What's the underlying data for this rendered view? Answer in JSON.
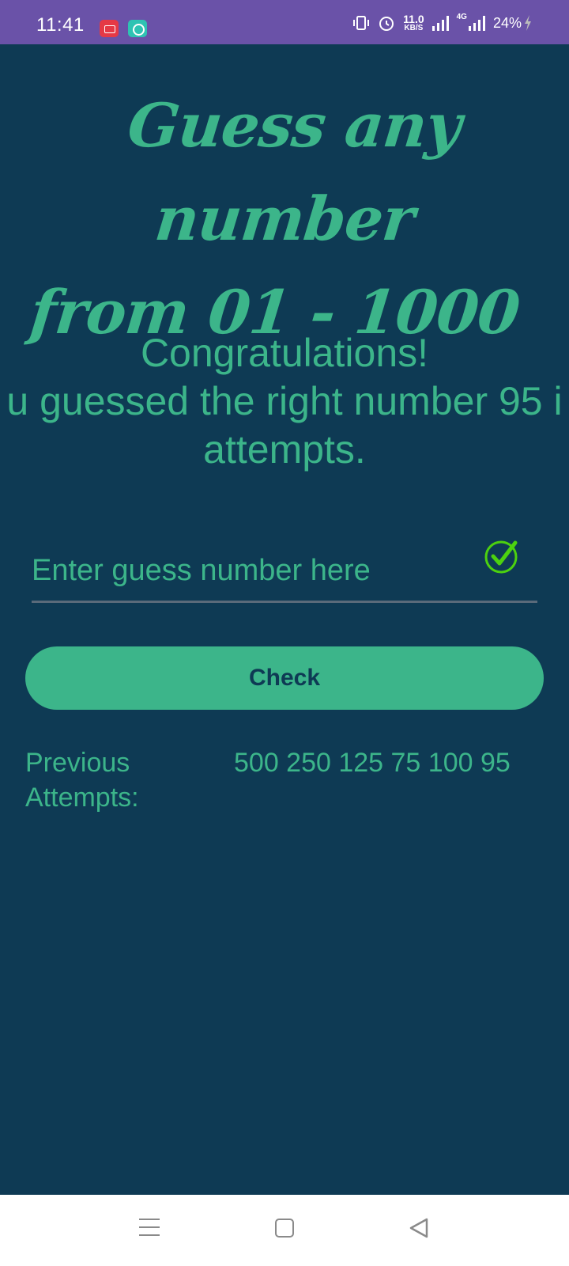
{
  "status_bar": {
    "time": "11:41",
    "speed_value": "11.0",
    "speed_unit": "KB/S",
    "network": "4G",
    "battery": "24%"
  },
  "title_lines": [
    "Guess any number",
    "from 01 - 1000"
  ],
  "result": {
    "line1": "Congratulations!",
    "line2": "u guessed the right number 95 i",
    "line3": "attempts."
  },
  "guess_input": {
    "placeholder": "Enter guess number here",
    "value": ""
  },
  "check_button_label": "Check",
  "previous_attempts": {
    "label": "Previous Attempts:",
    "values": "500 250 125 75 100 95"
  },
  "colors": {
    "accent": "#3cb58a",
    "background": "#0e3a54",
    "status_bar": "#6a52a8",
    "check_icon": "#4cd10f"
  },
  "icons": {
    "status": [
      "screen-record-icon",
      "chat-app-icon",
      "vibrate-icon",
      "alarm-icon",
      "signal-icon",
      "battery-charging-icon"
    ],
    "input": "check-circle-icon",
    "nav": [
      "menu-icon",
      "home-icon",
      "back-icon"
    ]
  }
}
